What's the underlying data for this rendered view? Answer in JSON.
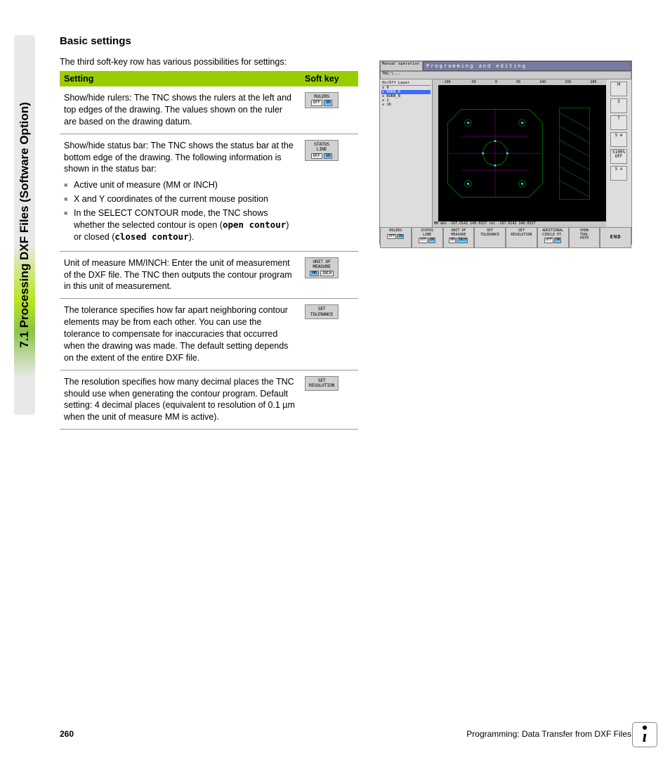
{
  "side_tab": "7.1 Processing DXF Files (Software Option)",
  "heading": "Basic settings",
  "intro": "The third soft-key row has various possibilities for settings:",
  "th_setting": "Setting",
  "th_softkey": "Soft key",
  "rows": [
    {
      "desc": "Show/hide rulers: The TNC shows the rulers at the left and top edges of the drawing. The values shown on the ruler are based on the drawing datum.",
      "btn": {
        "l1": "RULERS",
        "off": "OFF",
        "on": "ON",
        "type": "toggle"
      }
    },
    {
      "desc": "Show/hide status bar: The TNC shows the status bar at the bottom edge of the drawing. The following information is shown in the status bar:",
      "bullets": [
        "Active unit of measure (MM or INCH)",
        "X and Y coordinates of the current mouse position",
        "In the SELECT CONTOUR mode, the TNC shows whether the selected contour is open (<span class=\"mono\">open contour</span>) or closed (<span class=\"mono\">closed contour</span>)."
      ],
      "btn": {
        "l1": "STATUS",
        "l2": "LINE",
        "off": "OFF",
        "on": "ON",
        "type": "toggle"
      }
    },
    {
      "desc": "Unit of measure MM/INCH: Enter the unit of measurement of the DXF file. The TNC then outputs the contour program in this unit of measurement.",
      "btn": {
        "l1": "UNIT OF",
        "l2": "MEASURE",
        "off": "MM",
        "on": "INCH",
        "type": "toggle_mm"
      }
    },
    {
      "desc": "The tolerance specifies how far apart neighboring contour elements may be from each other. You can use the tolerance to compensate for inaccuracies that occurred when the drawing was made. The default setting depends on the extent of the entire DXF file.",
      "btn": {
        "l1": "SET",
        "l2": "TOLERANCE",
        "type": "plain"
      }
    },
    {
      "desc": "The resolution specifies how many decimal places the TNC should use when generating the contour program. Default setting: 4 decimal places (equivalent to resolution of 0.1 µm when the unit of measure MM is active).",
      "btn": {
        "l1": "SET",
        "l2": "RESOLUTION",
        "type": "plain"
      }
    }
  ],
  "screenshot": {
    "mode": "Manual operation",
    "title": "Programming and editing",
    "path": "TNC:\\...",
    "layer_hdr": {
      "a": "On/Off",
      "b": "Layer"
    },
    "layers": [
      {
        "onoff": "☒",
        "name": "0"
      },
      {
        "onoff": "☒",
        "name": "NURB_K",
        "sel": true
      },
      {
        "onoff": "☒",
        "name": "NURB_B"
      },
      {
        "onoff": "☒",
        "name": "1"
      },
      {
        "onoff": "☒",
        "name": "16"
      }
    ],
    "ruler_vals": [
      "-100",
      "-50",
      "0",
      "50",
      "100",
      "150",
      "200"
    ],
    "status": "MM  abs -107.0142 140.0327  rel -107.0142 140.0327",
    "side_btns": [
      "M",
      "S",
      "T",
      "S ⊕",
      "S100% OFF",
      "S ⊖"
    ],
    "soft": [
      {
        "l1": "RULERS",
        "tog": [
          "OFF",
          "ON"
        ]
      },
      {
        "l1": "STATUS",
        "l2": "LINE",
        "tog": [
          "OFF",
          "ON"
        ]
      },
      {
        "l1": "UNIT OF",
        "l2": "MEASURE",
        "tog": [
          "MM",
          "INCH"
        ]
      },
      {
        "l1": "SET",
        "l2": "TOLERANCE"
      },
      {
        "l1": "SET",
        "l2": "RESOLUTION"
      },
      {
        "l1": "ADDITIONAL",
        "l2": "CIRCLE PT.",
        "tog": [
          "OFF",
          "ON"
        ]
      },
      {
        "l1": "SHOW",
        "l2": "TOOL",
        "l3": "PATH"
      },
      {
        "l1": "END",
        "end": true
      }
    ]
  },
  "footer": {
    "page": "260",
    "chapter": "Programming: Data Transfer from DXF Files"
  }
}
